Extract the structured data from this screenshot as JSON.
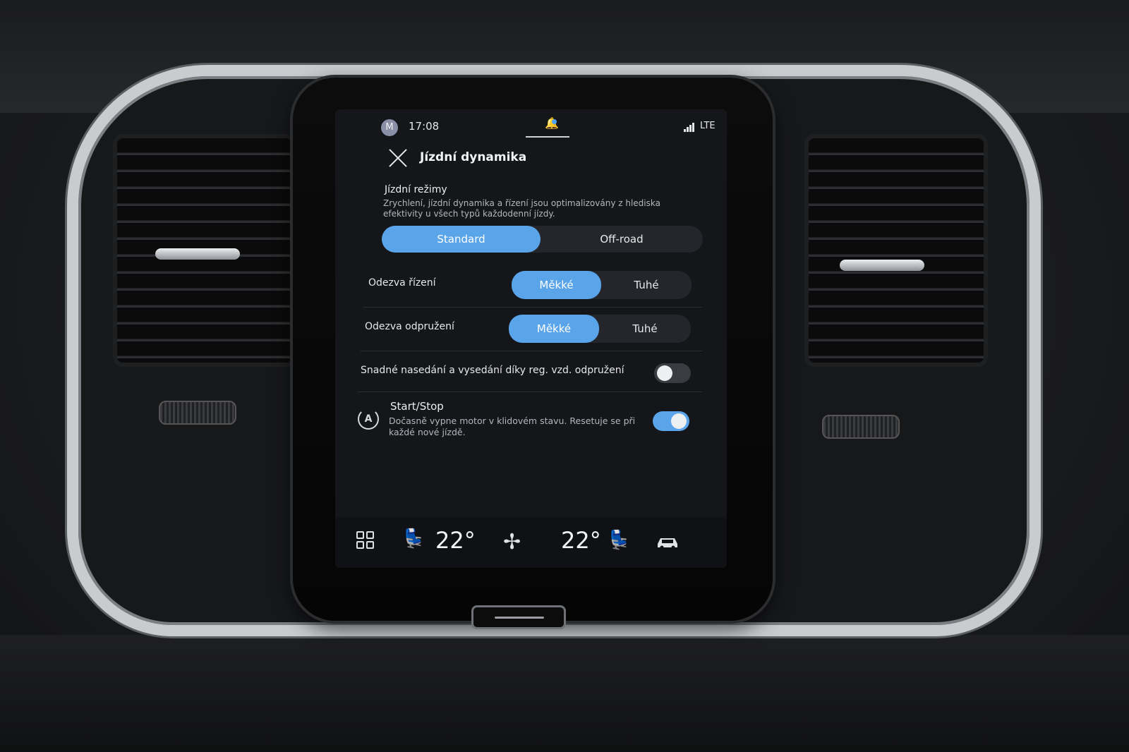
{
  "status": {
    "avatar_initial": "M",
    "time": "17:08",
    "network": "LTE"
  },
  "header": {
    "title": "Jízdní dynamika"
  },
  "drive_modes": {
    "title": "Jízdní režimy",
    "description": "Zrychlení, jízdní dynamika a řízení jsou optimalizovány z hlediska efektivity u všech typů každodenní jízdy.",
    "options": [
      "Standard",
      "Off-road"
    ],
    "selected": "Standard"
  },
  "steering": {
    "label": "Odezva řízení",
    "options": [
      "Měkké",
      "Tuhé"
    ],
    "selected": "Měkké"
  },
  "suspension": {
    "label": "Odezva odpružení",
    "options": [
      "Měkké",
      "Tuhé"
    ],
    "selected": "Měkké"
  },
  "easy_entry": {
    "label": "Snadné nasedání a vysedání díky reg. vzd. odpružení",
    "enabled": false
  },
  "start_stop": {
    "icon_letter": "A",
    "title": "Start/Stop",
    "description": "Dočasně vypne motor v klidovém stavu. Resetuje se při každé nové jízdě.",
    "enabled": true
  },
  "climate": {
    "driver_temp": "22°",
    "passenger_temp": "22°",
    "icons": [
      "apps-grid-icon",
      "driver-seat-heat-icon",
      "fan-icon",
      "passenger-seat-icon",
      "car-icon"
    ]
  },
  "colors": {
    "accent": "#5aa5ea",
    "screen_bg": "#15161a"
  }
}
